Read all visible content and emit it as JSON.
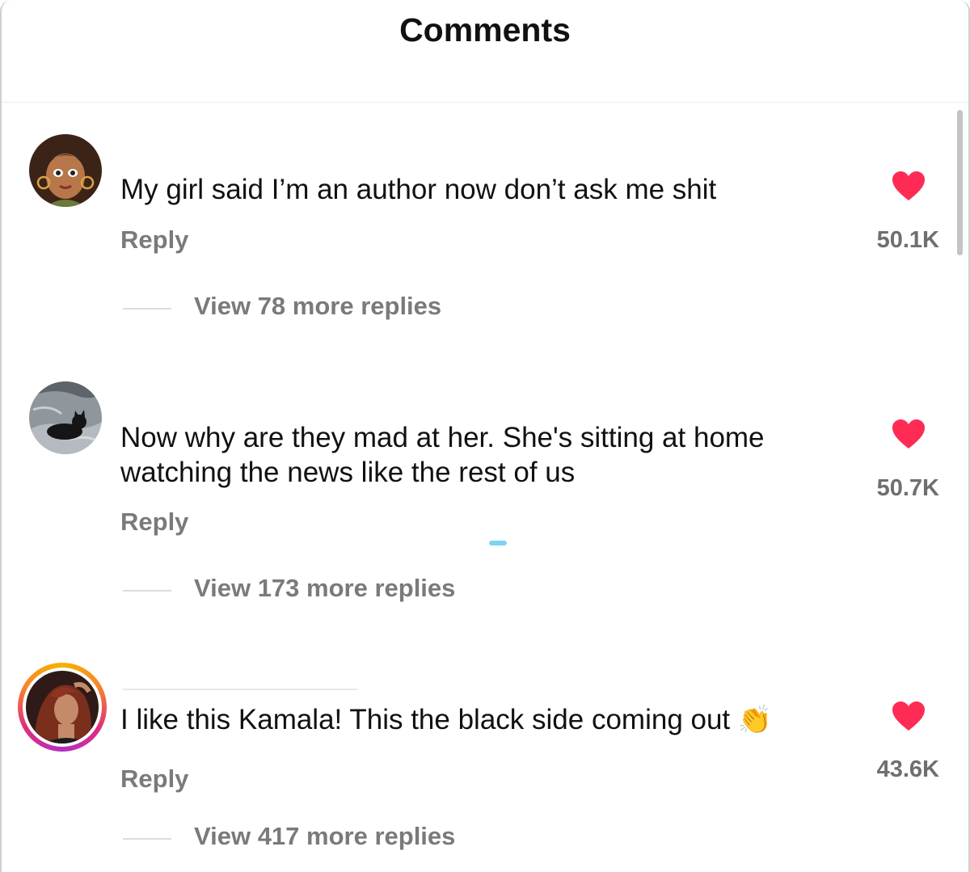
{
  "header": {
    "title": "Comments"
  },
  "comments": [
    {
      "text": "My girl said I’m an author now don’t ask me shit",
      "reply_label": "Reply",
      "likes": "50.1K",
      "view_replies": "View 78 more replies",
      "avatar_icon": "cartoon-girl-avatar"
    },
    {
      "text": "Now why are they mad at her. She's sitting at home watching the news like the rest of us",
      "reply_label": "Reply",
      "likes": "50.7K",
      "view_replies": "View 173 more replies",
      "avatar_icon": "black-cat-avatar"
    },
    {
      "text": "I like this Kamala! This the black side coming out",
      "emoji": "👏",
      "reply_label": "Reply",
      "likes": "43.6K",
      "view_replies": "View 417 more replies",
      "avatar_icon": "woman-photo-avatar-story-ring"
    }
  ],
  "colors": {
    "like_red": "#fe2c55",
    "muted_text": "#7a7a7a",
    "story_ring": [
      "#f5b400",
      "#e02c7d",
      "#b52ec4"
    ]
  }
}
